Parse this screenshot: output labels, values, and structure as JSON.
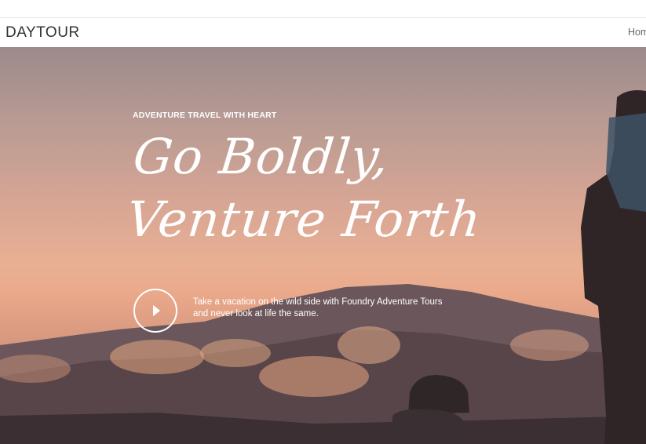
{
  "header": {
    "brand": "DAYTOUR",
    "nav_items": [
      "Hom"
    ]
  },
  "hero": {
    "eyebrow": "ADVENTURE TRAVEL WITH HEART",
    "headline_line1": "Go Boldly,",
    "headline_line2": "Venture Forth",
    "description": "Take a vacation on the wild side with Foundry Adventure Tours and never look at life the same.",
    "play_icon": "play-icon"
  },
  "colors": {
    "sky_top": "#9c8a8b",
    "sky_glow": "#eba98b",
    "mountain": "#5a4a4f",
    "text": "#ffffff"
  }
}
